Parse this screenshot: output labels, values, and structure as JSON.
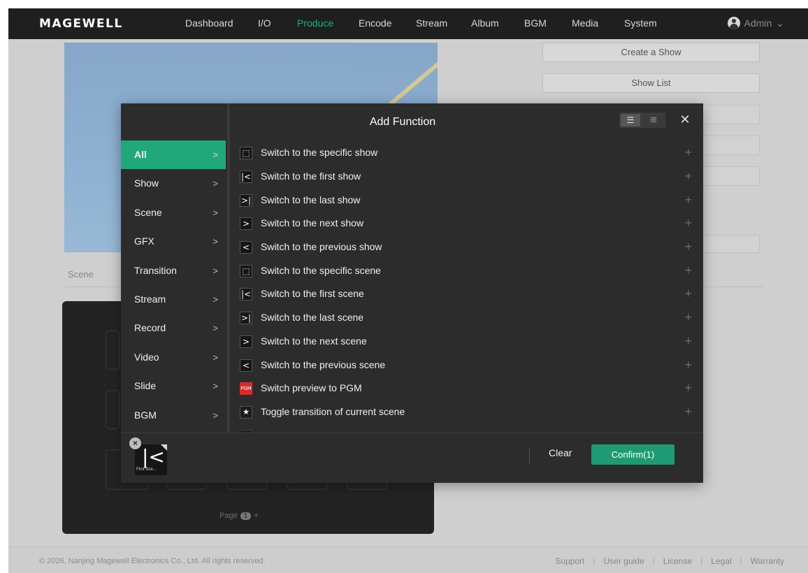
{
  "nav": {
    "logo": "MAGEWELL",
    "items": [
      {
        "label": "Dashboard"
      },
      {
        "label": "I/O"
      },
      {
        "label": "Produce"
      },
      {
        "label": "Encode"
      },
      {
        "label": "Stream"
      },
      {
        "label": "Album"
      },
      {
        "label": "BGM"
      },
      {
        "label": "Media"
      },
      {
        "label": "System"
      }
    ],
    "active": "Produce",
    "user": "Admin",
    "user_chevron": "⌄"
  },
  "page": {
    "create_show": "Create a Show",
    "show_list": "Show List",
    "scene_label": "Scene",
    "page_label": "Page",
    "page_number": "1",
    "page_next": "+"
  },
  "footer": {
    "copyright": "© 2026, Nanjing Magewell Electronics Co., Ltd. All rights reserved.",
    "links": [
      "Support",
      "User guide",
      "License",
      "Legal",
      "Warranty"
    ]
  },
  "modal": {
    "title": "Add Function",
    "view_list_icon": "☰",
    "view_grid_icon": "⊞",
    "close": "✕",
    "categories": [
      {
        "label": "All",
        "chev": ">"
      },
      {
        "label": "Show",
        "chev": ">"
      },
      {
        "label": "Scene",
        "chev": ">"
      },
      {
        "label": "GFX",
        "chev": ">"
      },
      {
        "label": "Transition",
        "chev": ">"
      },
      {
        "label": "Stream",
        "chev": ">"
      },
      {
        "label": "Record",
        "chev": ">"
      },
      {
        "label": "Video",
        "chev": ">"
      },
      {
        "label": "Slide",
        "chev": ">"
      },
      {
        "label": "BGM",
        "chev": ">"
      }
    ],
    "active_category": "All",
    "functions": [
      {
        "label": "Switch to the specific show",
        "icon": "specific-icon",
        "glyph": "⬚"
      },
      {
        "label": "Switch to the first show",
        "icon": "first-icon",
        "glyph": "|<"
      },
      {
        "label": "Switch to the last show",
        "icon": "last-icon",
        "glyph": ">|"
      },
      {
        "label": "Switch to the next show",
        "icon": "next-icon",
        "glyph": ">"
      },
      {
        "label": "Switch to the previous show",
        "icon": "previous-icon",
        "glyph": "<"
      },
      {
        "label": "Switch to the specific scene",
        "icon": "specific-icon",
        "glyph": "⬚"
      },
      {
        "label": "Switch to the first scene",
        "icon": "first-icon",
        "glyph": "|<"
      },
      {
        "label": "Switch to the last scene",
        "icon": "last-icon",
        "glyph": ">|"
      },
      {
        "label": "Switch to the next scene",
        "icon": "next-icon",
        "glyph": ">"
      },
      {
        "label": "Switch to the previous scene",
        "icon": "previous-icon",
        "glyph": "<"
      },
      {
        "label": "Switch preview to PGM",
        "icon": "pgm-icon",
        "glyph": "PGM"
      },
      {
        "label": "Toggle transition of current scene",
        "icon": "star-icon",
        "glyph": "★"
      }
    ],
    "add_symbol": "+",
    "selected": {
      "glyph": "|<",
      "caption": "First Sce...",
      "remove": "×"
    },
    "clear": "Clear",
    "confirm": "Confirm(1)"
  },
  "colors": {
    "accent": "#20a77a",
    "topbar": "#1f1f1f",
    "modal_bg": "#2c2c2c"
  }
}
